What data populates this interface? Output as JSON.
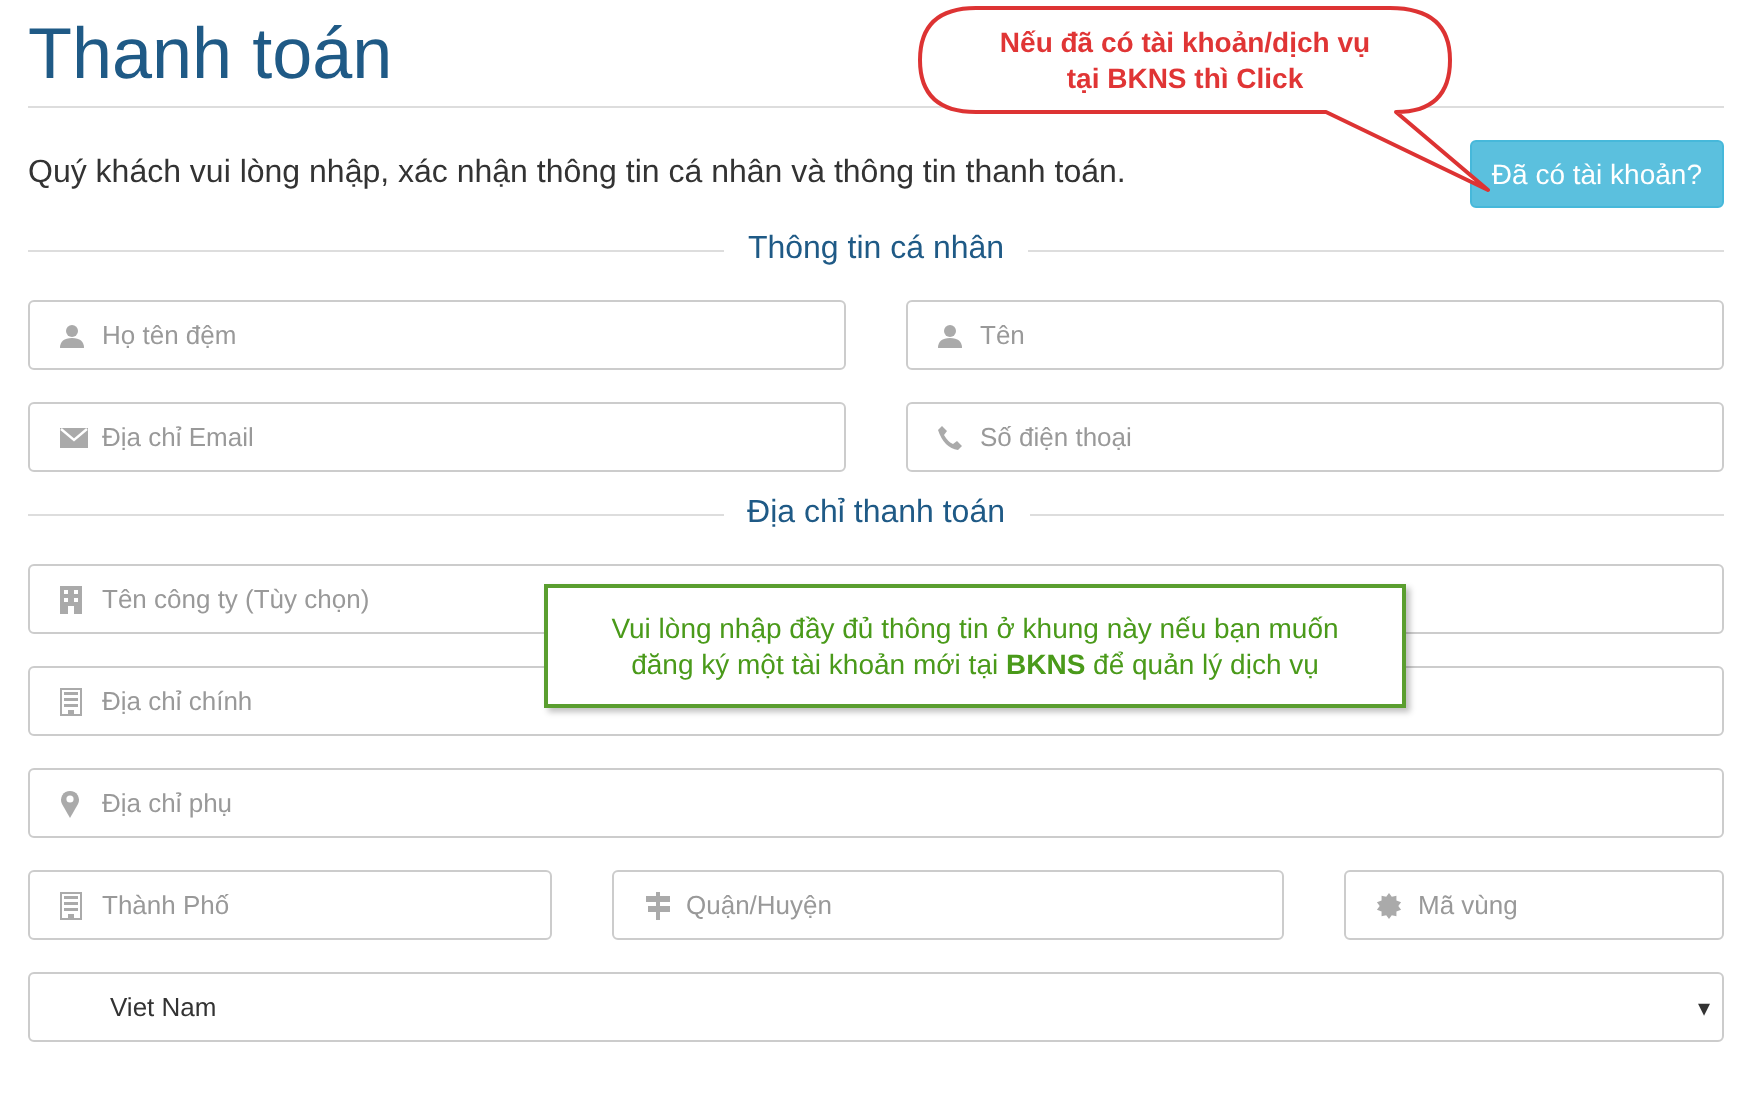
{
  "title": "Thanh toán",
  "intro": "Quý khách vui lòng nhập, xác nhận thông tin cá nhân và thông tin thanh toán.",
  "account_button": "Đã có tài khoản?",
  "callout": {
    "lines": [
      "Nếu đã có tài khoản/dịch vụ",
      "tại BKNS thì Click"
    ]
  },
  "note": {
    "lines": [
      "Vui lòng nhập đầy đủ thông tin ở khung này nếu bạn muốn",
      "đăng ký một tài khoản mới tại **BKNS** để quản lý dịch vụ"
    ]
  },
  "sections": [
    {
      "heading": "Thông tin cá nhân",
      "rows": [
        [
          {
            "kind": "input",
            "placeholder": "Họ tên đệm"
          },
          {
            "kind": "input",
            "placeholder": "Tên"
          }
        ],
        [
          {
            "kind": "input",
            "placeholder": "Địa chỉ Email"
          },
          {
            "kind": "input",
            "placeholder": "Số điện thoại"
          }
        ]
      ]
    },
    {
      "heading": "Địa chỉ thanh toán",
      "rows": [
        [
          {
            "kind": "input",
            "placeholder": "Tên công ty (Tùy chọn)"
          }
        ],
        [
          {
            "kind": "input",
            "placeholder": "Địa chỉ chính"
          }
        ],
        [
          {
            "kind": "input",
            "placeholder": "Địa chỉ phụ"
          }
        ],
        [
          {
            "kind": "input",
            "placeholder": "Thành Phố"
          },
          {
            "kind": "input",
            "placeholder": "Quận/Huyện"
          },
          {
            "kind": "input",
            "placeholder": "Mã vùng"
          }
        ],
        [
          {
            "kind": "select",
            "value": "Viet Nam",
            "arrow": "▾"
          }
        ]
      ]
    }
  ]
}
